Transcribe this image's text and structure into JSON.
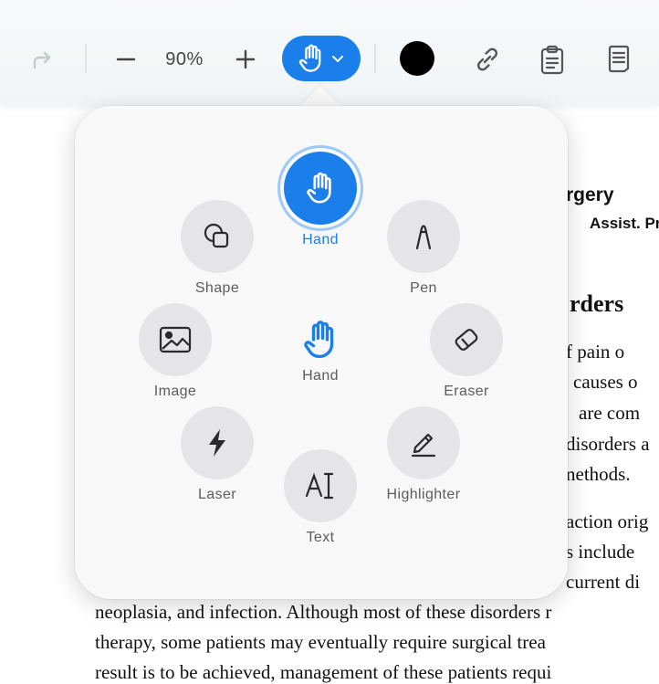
{
  "toolbar": {
    "zoom": "90%",
    "current_color": "#000000",
    "accent": "#1a7fea"
  },
  "document": {
    "line1": "rgery",
    "line2": "Assist. Pr",
    "heading": "rders",
    "para1": "f pain o",
    "para2": "causes o",
    "para3": "are com",
    "para4": "disorders a",
    "para5": "nethods.",
    "para6": "action orig",
    "para7": "s include",
    "para8": "current di",
    "para9": "neoplasia, and infection. Although most of these disorders r",
    "para10": "therapy, some patients may eventually require surgical trea",
    "para11": "result is to be achieved, management of these patients requi"
  },
  "tools": [
    {
      "name": "Hand",
      "icon": "hand-icon",
      "selected": true
    },
    {
      "name": "Shape",
      "icon": "shape-icon"
    },
    {
      "name": "Pen",
      "icon": "pen-icon"
    },
    {
      "name": "Image",
      "icon": "image-icon"
    },
    {
      "name": "Eraser",
      "icon": "eraser-icon"
    },
    {
      "name": "Laser",
      "icon": "laser-icon"
    },
    {
      "name": "Highlighter",
      "icon": "highlighter-icon"
    },
    {
      "name": "Text",
      "icon": "text-icon"
    }
  ],
  "center_label": "Hand"
}
